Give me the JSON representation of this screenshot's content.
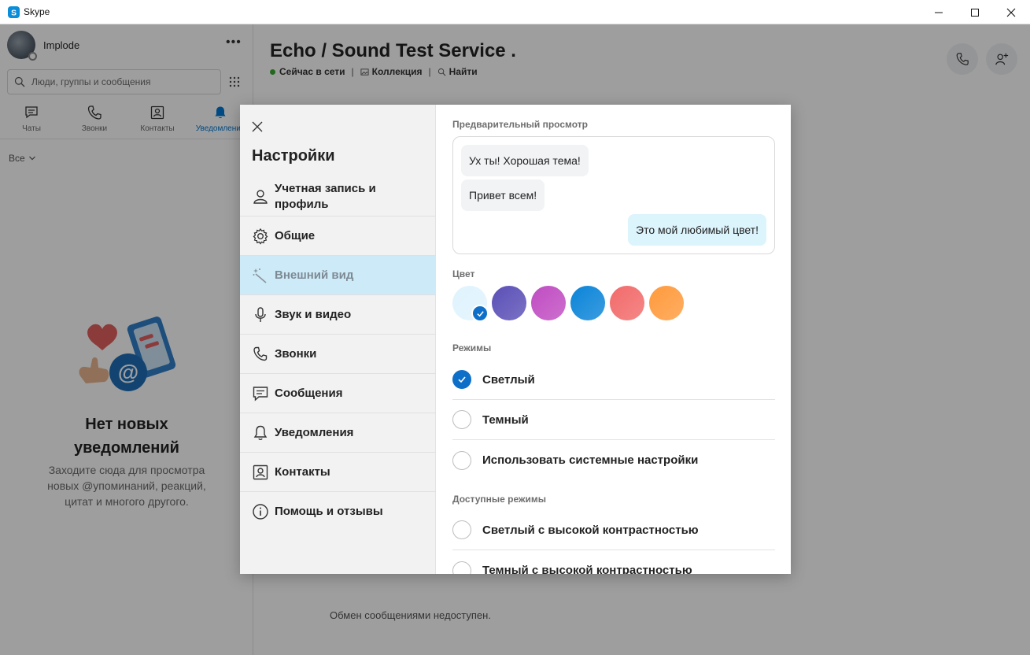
{
  "window": {
    "title": "Skype"
  },
  "profile": {
    "name": "Implode"
  },
  "search": {
    "placeholder": "Люди, группы и сообщения"
  },
  "nav_tabs": [
    {
      "label": "Чаты",
      "icon": "chat-icon"
    },
    {
      "label": "Звонки",
      "icon": "phone-icon"
    },
    {
      "label": "Контакты",
      "icon": "contacts-icon"
    },
    {
      "label": "Уведомления",
      "icon": "bell-icon",
      "active": true
    }
  ],
  "filter": {
    "label": "Все"
  },
  "empty_state": {
    "title_line1": "Нет новых",
    "title_line2": "уведомлений",
    "desc_line1": "Заходите сюда для просмотра",
    "desc_line2": "новых @упоминаний, реакций,",
    "desc_line3": "цитат и многого другого."
  },
  "chat": {
    "title": "Echo / Sound Test Service .",
    "status": "Сейчас в сети",
    "gallery": "Коллекция",
    "find": "Найти",
    "unavailable": "Обмен сообщениями недоступен."
  },
  "settings": {
    "title": "Настройки",
    "menu": [
      {
        "label_line1": "Учетная запись и",
        "label_line2": "профиль",
        "icon": "person-icon"
      },
      {
        "label_line1": "Общие",
        "icon": "gear-icon"
      },
      {
        "label_line1": "Внешний вид",
        "icon": "magic-wand-icon",
        "active": true
      },
      {
        "label_line1": "Звук и видео",
        "icon": "microphone-icon"
      },
      {
        "label_line1": "Звонки",
        "icon": "phone-icon"
      },
      {
        "label_line1": "Сообщения",
        "icon": "message-icon"
      },
      {
        "label_line1": "Уведомления",
        "icon": "bell-icon"
      },
      {
        "label_line1": "Контакты",
        "icon": "contacts-icon"
      },
      {
        "label_line1": "Помощь и отзывы",
        "icon": "info-icon"
      }
    ],
    "preview": {
      "label": "Предварительный просмотр",
      "msg1": "Ух ты! Хорошая тема!",
      "msg2": "Привет всем!",
      "msg3": "Это мой любимый цвет!"
    },
    "color": {
      "label": "Цвет",
      "swatches": [
        "#dff3fd",
        "#5a4fb6",
        "#c04cc2",
        "#0a84d8",
        "#f26a6a",
        "#ff9a3c"
      ],
      "selected_index": 0
    },
    "modes": {
      "label": "Режимы",
      "options": [
        "Светлый",
        "Темный",
        "Использовать системные настройки"
      ],
      "selected_index": 0
    },
    "available_modes": {
      "label": "Доступные режимы",
      "options": [
        "Светлый с высокой контрастностью",
        "Темный с высокой контрастностью"
      ]
    }
  },
  "colors": {
    "accent": "#0e6fc9",
    "active_menu": "#cdeaf8"
  }
}
